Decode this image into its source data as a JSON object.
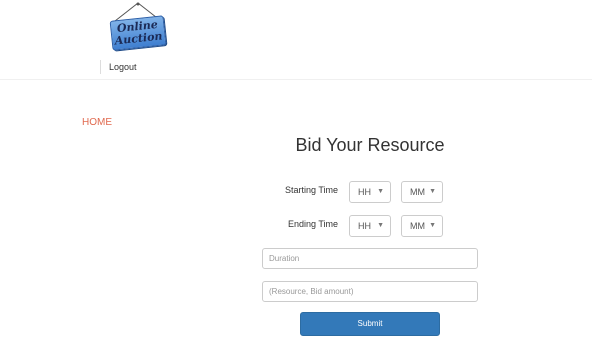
{
  "header": {
    "logo": {
      "line1": "Online",
      "line2": "Auction"
    },
    "logout_label": "Logout"
  },
  "nav": {
    "home_label": "HOME"
  },
  "form": {
    "title": "Bid Your Resource",
    "starting_time": {
      "label": "Starting Time",
      "hour_value": "HH",
      "minute_value": "MM"
    },
    "ending_time": {
      "label": "Ending Time",
      "hour_value": "HH",
      "minute_value": "MM"
    },
    "duration_placeholder": "Duration",
    "resource_placeholder": "(Resource, Bid amount)",
    "submit_label": "Submit"
  },
  "colors": {
    "accent": "#3379b9",
    "link": "#e0694e"
  },
  "icons": {
    "dropdown": "caret-down-icon"
  }
}
